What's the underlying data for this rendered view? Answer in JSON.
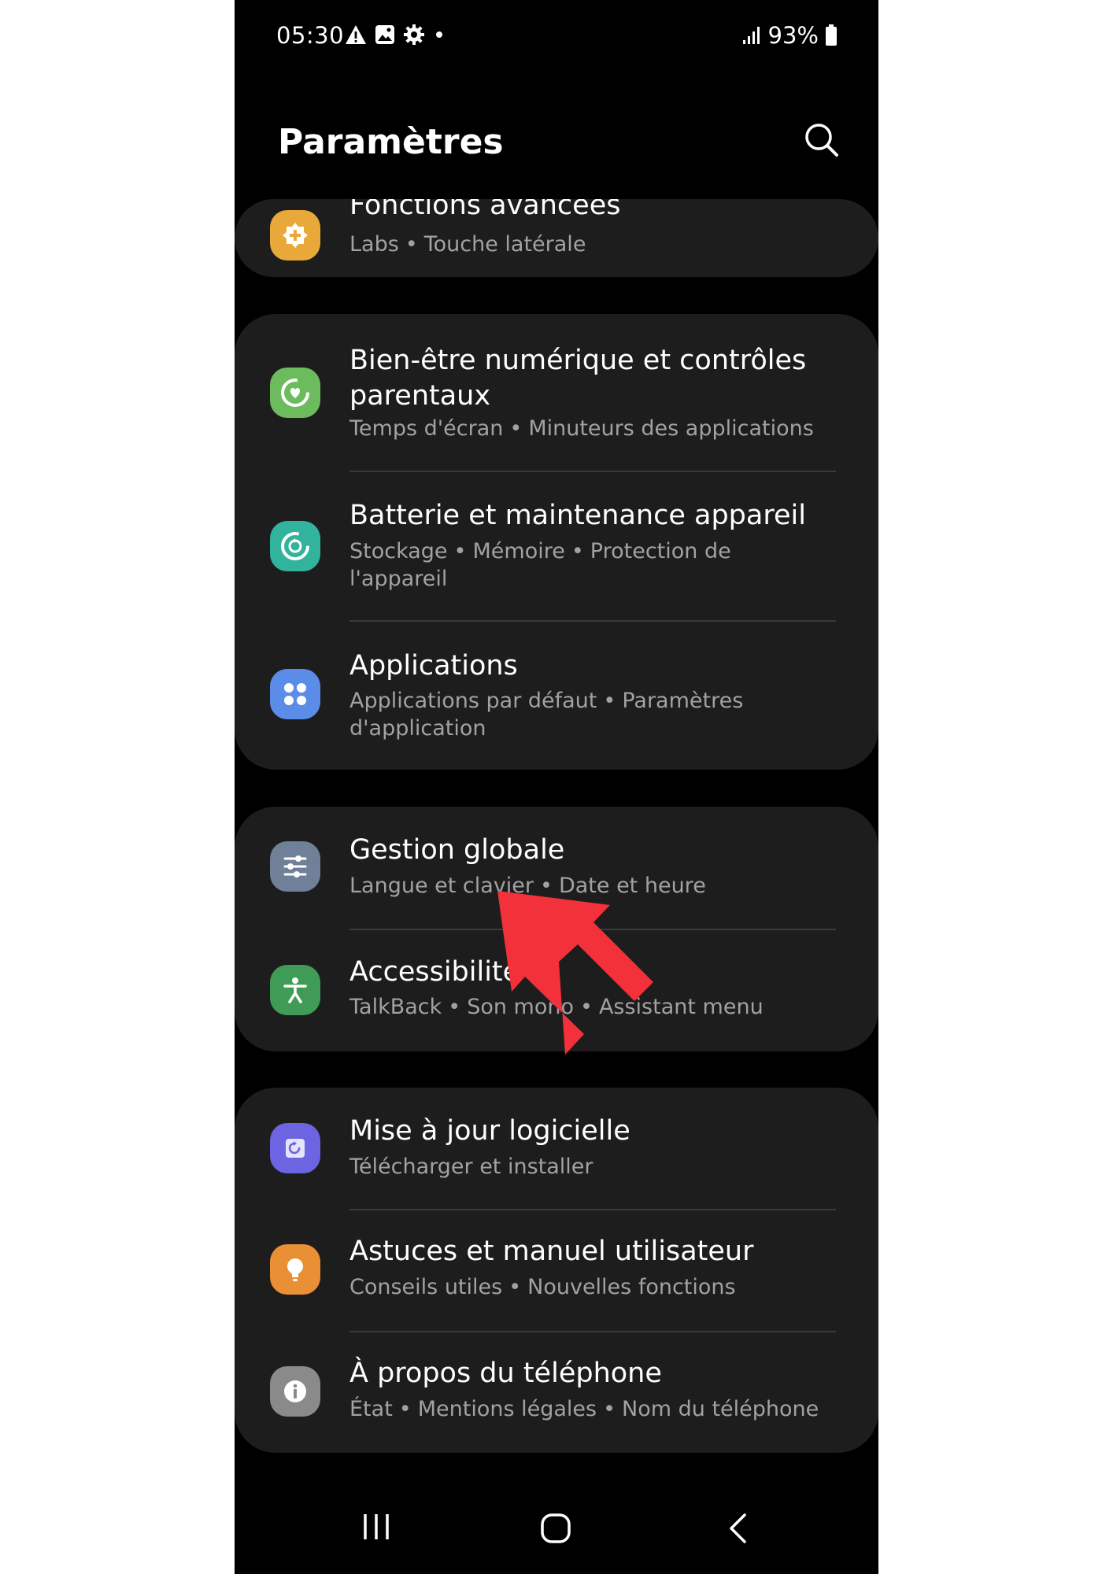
{
  "status_bar": {
    "time": "05:30",
    "battery": "93%"
  },
  "header": {
    "title": "Paramètres"
  },
  "groups": [
    {
      "items": [
        {
          "title": "Fonctions avancées",
          "subtitle": [
            "Labs",
            "Touche latérale"
          ],
          "icon": "advanced-features-icon",
          "color": "#e9a93a"
        }
      ]
    },
    {
      "items": [
        {
          "title": "Bien-être numérique et contrôles parentaux",
          "subtitle": [
            "Temps d'écran",
            "Minuteurs des applications"
          ],
          "icon": "digital-wellbeing-icon",
          "color": "#6cbc5e"
        },
        {
          "title": "Batterie et maintenance appareil",
          "subtitle": [
            "Stockage",
            "Mémoire",
            "Protection de l'appareil"
          ],
          "icon": "device-care-icon",
          "color": "#32b39d"
        },
        {
          "title": "Applications",
          "subtitle": [
            "Applications par défaut",
            "Paramètres d'application"
          ],
          "icon": "apps-icon",
          "color": "#5b8de8"
        }
      ]
    },
    {
      "items": [
        {
          "title": "Gestion globale",
          "subtitle": [
            "Langue et clavier",
            "Date et heure"
          ],
          "icon": "general-management-icon",
          "color": "#6f8098"
        },
        {
          "title": "Accessibilité",
          "subtitle": [
            "TalkBack",
            "Son mono",
            "Assistant menu"
          ],
          "icon": "accessibility-icon",
          "color": "#3f9b55"
        }
      ]
    },
    {
      "items": [
        {
          "title": "Mise à jour logicielle",
          "subtitle": [
            "Télécharger et installer"
          ],
          "icon": "software-update-icon",
          "color": "#6c64e0"
        },
        {
          "title": "Astuces et manuel utilisateur",
          "subtitle": [
            "Conseils utiles",
            "Nouvelles fonctions"
          ],
          "icon": "tips-icon",
          "color": "#e98f35"
        },
        {
          "title": "À propos du téléphone",
          "subtitle": [
            "État",
            "Mentions légales",
            "Nom du téléphone"
          ],
          "icon": "about-phone-icon",
          "color": "#8a8a8a"
        }
      ]
    }
  ],
  "annotation": {
    "arrow_color": "#f2313a"
  }
}
